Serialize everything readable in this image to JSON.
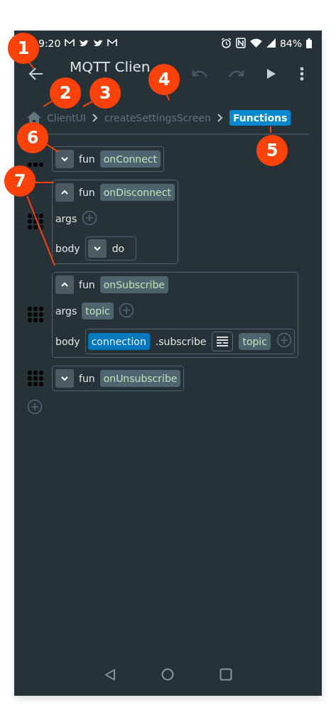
{
  "status_bar": {
    "time": "9:20",
    "battery": "84%"
  },
  "toolbar": {
    "title": "MQTT Clien",
    "undo_disabled": true,
    "redo_disabled": true
  },
  "breadcrumb": [
    {
      "label": "ClientUI",
      "selected": false
    },
    {
      "label": "createSettingsScreen",
      "selected": false
    },
    {
      "label": "Functions",
      "selected": true
    }
  ],
  "functions": [
    {
      "keyword": "fun",
      "name": "onConnect",
      "expanded": false
    },
    {
      "keyword": "fun",
      "name": "onDisconnect",
      "expanded": true,
      "args_label": "args",
      "body_label": "body",
      "body": {
        "kind": "do",
        "label": "do",
        "expanded": false
      }
    },
    {
      "keyword": "fun",
      "name": "onSubscribe",
      "expanded": true,
      "args_label": "args",
      "args": [
        "topic"
      ],
      "body_label": "body",
      "body": {
        "kind": "call",
        "receiver": "connection",
        "method": ".subscribe",
        "args": [
          "topic"
        ]
      }
    },
    {
      "keyword": "fun",
      "name": "onUnsubscribe",
      "expanded": false
    }
  ],
  "callouts": [
    {
      "number": "1"
    },
    {
      "number": "2"
    },
    {
      "number": "3"
    },
    {
      "number": "4"
    },
    {
      "number": "5"
    },
    {
      "number": "6"
    },
    {
      "number": "7"
    }
  ]
}
